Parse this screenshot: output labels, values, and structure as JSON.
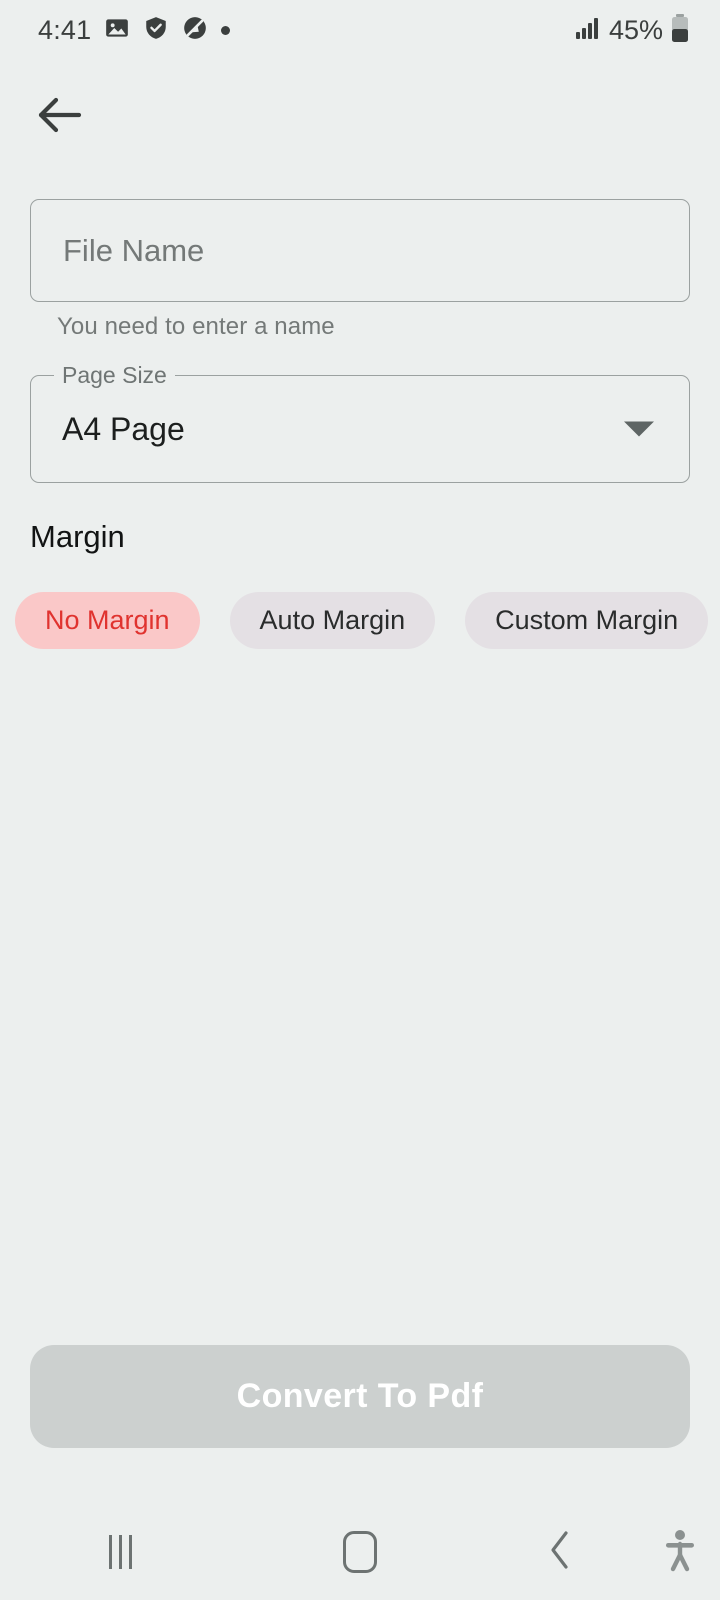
{
  "status_bar": {
    "time": "4:41",
    "icons": [
      "image-icon",
      "shield-check-icon",
      "mute-notifications-icon",
      "dot-icon"
    ],
    "battery_percent": "45%",
    "signal_icon": "signal-bars-icon",
    "battery_icon": "battery-icon"
  },
  "appbar": {
    "back_icon": "back-arrow-icon"
  },
  "form": {
    "filename": {
      "label": "File Name",
      "placeholder": "File Name",
      "value": "",
      "helper_text": "You need to enter a name"
    },
    "page_size": {
      "label": "Page Size",
      "value": "A4 Page",
      "arrow_icon": "chevron-down-icon"
    },
    "margin": {
      "title": "Margin",
      "options": [
        {
          "label": "No Margin",
          "selected": true
        },
        {
          "label": "Auto Margin",
          "selected": false
        },
        {
          "label": "Custom Margin",
          "selected": false
        }
      ]
    }
  },
  "actions": {
    "convert_label": "Convert To Pdf"
  },
  "navbar": {
    "recents": "recents-icon",
    "home": "home-icon",
    "back": "back-chevron-icon",
    "accessibility": "accessibility-icon"
  },
  "colors": {
    "background": "#ecefee",
    "chip_selected_bg": "#fac8c8",
    "chip_selected_text": "#e0332f",
    "chip_bg": "#e4e0e4",
    "chip_text": "#2a2c2c",
    "button_bg": "#ccd0cf",
    "button_text": "#ffffff",
    "border": "#9ba1a0",
    "helper_text": "#747978"
  }
}
